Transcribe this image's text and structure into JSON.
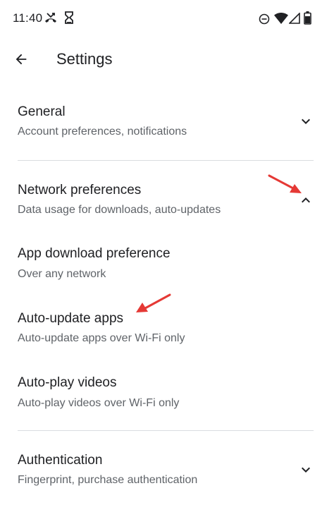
{
  "status_bar": {
    "time": "11:40",
    "icons": [
      "missed-call-icon",
      "hourglass-icon",
      "do-not-disturb-icon",
      "wifi-icon",
      "signal-icon",
      "battery-icon"
    ]
  },
  "app_bar": {
    "title": "Settings",
    "back_icon": "arrow-back-icon"
  },
  "sections": [
    {
      "title": "General",
      "subtitle": "Account preferences, notifications",
      "state": "collapsed"
    },
    {
      "title": "Network preferences",
      "subtitle": "Data usage for downloads, auto-updates",
      "state": "expanded",
      "items": [
        {
          "title": "App download preference",
          "subtitle": "Over any network"
        },
        {
          "title": "Auto-update apps",
          "subtitle": "Auto-update apps over Wi-Fi only"
        },
        {
          "title": "Auto-play videos",
          "subtitle": "Auto-play videos over Wi-Fi only"
        }
      ]
    },
    {
      "title": "Authentication",
      "subtitle": "Fingerprint, purchase authentication",
      "state": "collapsed"
    }
  ],
  "colors": {
    "text_primary": "#202124",
    "text_secondary": "#5f6368",
    "divider": "#dadce0",
    "annotation_arrow": "#e53935"
  }
}
